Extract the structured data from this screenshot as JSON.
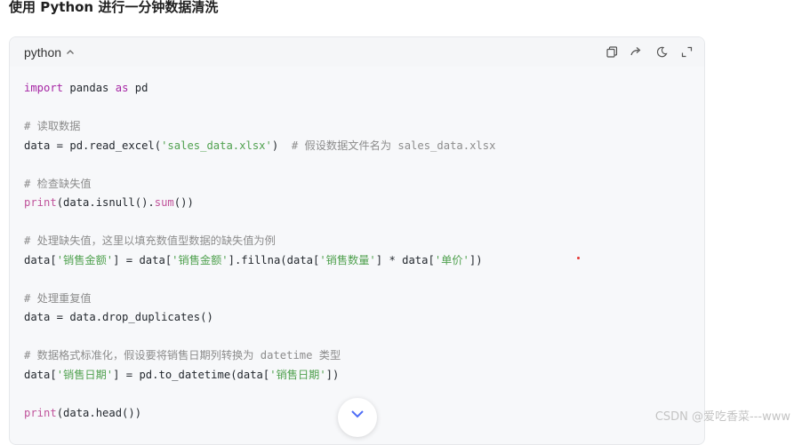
{
  "title": "使用 Python 进行一分钟数据清洗",
  "code_block": {
    "language": "python",
    "tools": [
      {
        "name": "copy-icon"
      },
      {
        "name": "share-icon"
      },
      {
        "name": "theme-icon"
      },
      {
        "name": "expand-icon"
      }
    ],
    "lines": [
      [
        {
          "t": "import",
          "c": "kw"
        },
        {
          "t": " pandas "
        },
        {
          "t": "as",
          "c": "kw"
        },
        {
          "t": " pd"
        }
      ],
      [],
      [
        {
          "t": "# 读取数据",
          "c": "cm"
        }
      ],
      [
        {
          "t": "data = pd.read_excel("
        },
        {
          "t": "'sales_data.xlsx'",
          "c": "str"
        },
        {
          "t": ")  "
        },
        {
          "t": "# 假设数据文件名为 sales_data.xlsx",
          "c": "cm"
        }
      ],
      [],
      [
        {
          "t": "# 检查缺失值",
          "c": "cm"
        }
      ],
      [
        {
          "t": "print",
          "c": "bi"
        },
        {
          "t": "(data.isnull()."
        },
        {
          "t": "sum",
          "c": "bi"
        },
        {
          "t": "())"
        }
      ],
      [],
      [
        {
          "t": "# 处理缺失值，这里以填充数值型数据的缺失值为例",
          "c": "cm"
        }
      ],
      [
        {
          "t": "data["
        },
        {
          "t": "'销售金额'",
          "c": "str"
        },
        {
          "t": "] = data["
        },
        {
          "t": "'销售金额'",
          "c": "str"
        },
        {
          "t": "].fillna(data["
        },
        {
          "t": "'销售数量'",
          "c": "str"
        },
        {
          "t": "] * data["
        },
        {
          "t": "'单价'",
          "c": "str"
        },
        {
          "t": "])"
        }
      ],
      [],
      [
        {
          "t": "# 处理重复值",
          "c": "cm"
        }
      ],
      [
        {
          "t": "data = data.drop_duplicates()"
        }
      ],
      [],
      [
        {
          "t": "# 数据格式标准化，假设要将销售日期列转换为 datetime 类型",
          "c": "cm"
        }
      ],
      [
        {
          "t": "data["
        },
        {
          "t": "'销售日期'",
          "c": "str"
        },
        {
          "t": "] = pd.to_datetime(data["
        },
        {
          "t": "'销售日期'",
          "c": "str"
        },
        {
          "t": "])"
        }
      ],
      [],
      [
        {
          "t": "print",
          "c": "bi"
        },
        {
          "t": "(data.head())"
        }
      ]
    ]
  },
  "watermark": "CSDN @爱吃香菜---www"
}
